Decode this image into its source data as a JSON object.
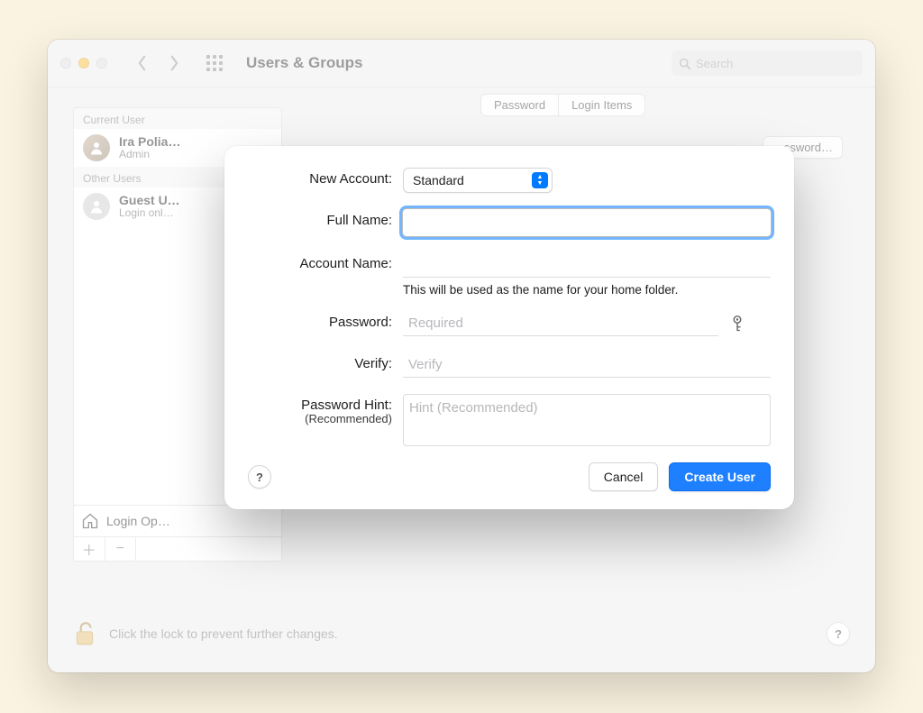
{
  "window": {
    "title": "Users & Groups",
    "search_placeholder": "Search"
  },
  "sidebar": {
    "current_user_header": "Current User",
    "other_users_header": "Other Users",
    "current_user": {
      "name": "Ira Polia…",
      "role": "Admin"
    },
    "other_users": [
      {
        "name": "Guest U…",
        "role": "Login onl…"
      }
    ],
    "login_options_label": "Login Op…"
  },
  "tabs": {
    "password": "Password",
    "login_items": "Login Items"
  },
  "change_password_btn": "…ssword…",
  "footer": {
    "lock_text": "Click the lock to prevent further changes."
  },
  "sheet": {
    "labels": {
      "new_account": "New Account:",
      "full_name": "Full Name:",
      "account_name": "Account Name:",
      "account_name_hint": "This will be used as the name for your home folder.",
      "password": "Password:",
      "verify": "Verify:",
      "password_hint": "Password Hint:",
      "password_hint_sub": "(Recommended)"
    },
    "placeholders": {
      "password": "Required",
      "verify": "Verify",
      "hint": "Hint (Recommended)"
    },
    "values": {
      "account_type": "Standard",
      "full_name": "",
      "account_name": "",
      "password": "",
      "verify": "",
      "hint": ""
    },
    "buttons": {
      "cancel": "Cancel",
      "create": "Create User"
    }
  },
  "glyphs": {
    "question": "?",
    "plus": "＋",
    "minus": "−"
  }
}
